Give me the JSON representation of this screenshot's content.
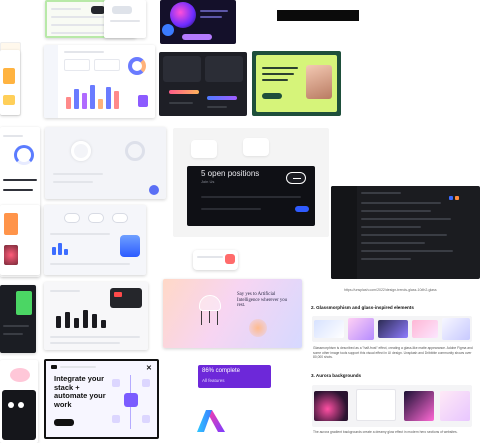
{
  "careers_card": {
    "title": "5 open positions",
    "subtitle": "Join Us"
  },
  "ai_card": {
    "headline": "Say yes to Artificial Intelligence wherever you rest."
  },
  "integrate_card": {
    "headline": "Integrate your stack + automate your work"
  },
  "complete_card": {
    "title": "86% complete",
    "subtitle": "All features"
  },
  "article": {
    "link_caption": "https://unsplash.com/2022/design-trends-glass-10#h2-glass",
    "section_2_title": "2. Glassmorphism and glass-inspired elements",
    "section_2_body": "Glassmorphism is described as a \"half-frost\" effect, creating a glass-like matte appearance. Adobe Figma and some other image tools support this visual effect in UI design. Unsplash and Dribbble community shows over 80,000 shots.",
    "section_3_title": "3. Aurora backgrounds",
    "section_3_body": "The aurora gradient backgrounds create a dreamy glow effect in modern hero sections of websites."
  },
  "colors": {
    "neon_green": "#8ddd6a",
    "accent_purple": "#6d28d9",
    "careers_bg": "#0f1015",
    "dashboard_blue": "#2f5bff"
  }
}
